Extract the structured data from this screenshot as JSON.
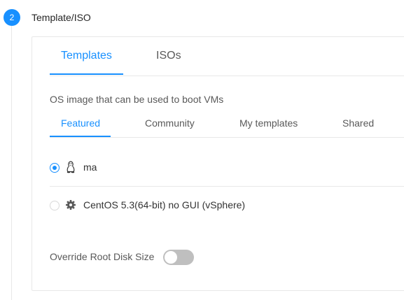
{
  "step": {
    "number": "2",
    "title": "Template/ISO"
  },
  "tabs": [
    {
      "label": "Templates",
      "active": true
    },
    {
      "label": "ISOs",
      "active": false
    }
  ],
  "description": "OS image that can be used to boot VMs",
  "filter_tabs": [
    {
      "label": "Featured",
      "active": true
    },
    {
      "label": "Community",
      "active": false
    },
    {
      "label": "My templates",
      "active": false
    },
    {
      "label": "Shared",
      "active": false
    }
  ],
  "templates": [
    {
      "name": "ma",
      "icon": "linux-icon",
      "selected": true
    },
    {
      "name": "CentOS 5.3(64-bit) no GUI (vSphere)",
      "icon": "gear-icon",
      "selected": false
    }
  ],
  "override_root_disk": {
    "label": "Override Root Disk Size",
    "enabled": false
  },
  "colors": {
    "accent": "#1890ff",
    "border": "#e8e8e8",
    "switch_off": "#bfbfbf"
  }
}
